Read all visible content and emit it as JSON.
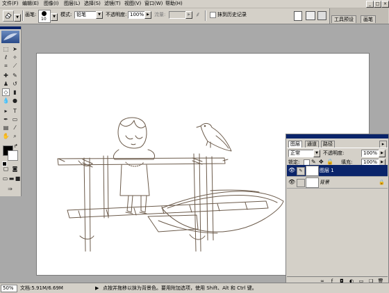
{
  "menu": [
    "文件(F)",
    "编辑(E)",
    "图像(I)",
    "图层(L)",
    "选择(S)",
    "滤镜(T)",
    "视图(V)",
    "窗口(W)",
    "帮助(H)"
  ],
  "window_controls": {
    "minimize": "_",
    "maximize": "□",
    "close": "×"
  },
  "options_bar": {
    "brush_label": "画笔:",
    "brush_size": "10",
    "mode_label": "模式:",
    "mode_value": "铅笔",
    "opacity_label": "不透明度:",
    "opacity_value": "100%",
    "flow_label": "流量:",
    "flow_value": "",
    "history_checkbox_label": "抹到历史记录",
    "palette_tabs": [
      "工具预设",
      "画笔"
    ]
  },
  "layers_panel": {
    "tabs": [
      "图层",
      "通道",
      "路径"
    ],
    "blend_mode": "正常",
    "opacity_label": "不透明度:",
    "opacity_value": "100%",
    "lock_label": "锁定:",
    "fill_label": "填充:",
    "fill_value": "100%",
    "layers": [
      {
        "name": "图层 1",
        "selected": true,
        "visible": true
      },
      {
        "name": "背景",
        "selected": false,
        "visible": true
      }
    ],
    "selected_color": "#0a246a"
  },
  "status_bar": {
    "zoom": "50%",
    "doc_info": "文档:5.91M/6.69M",
    "hint": "点按并拖移以抹为背景色。要用附加选项，使用 Shift、Alt 和 Ctrl 键。"
  },
  "icons": {
    "eraser": "eraser-icon",
    "eye": "eye-icon",
    "brush": "brush-icon",
    "airbrush": "airbrush-icon"
  }
}
